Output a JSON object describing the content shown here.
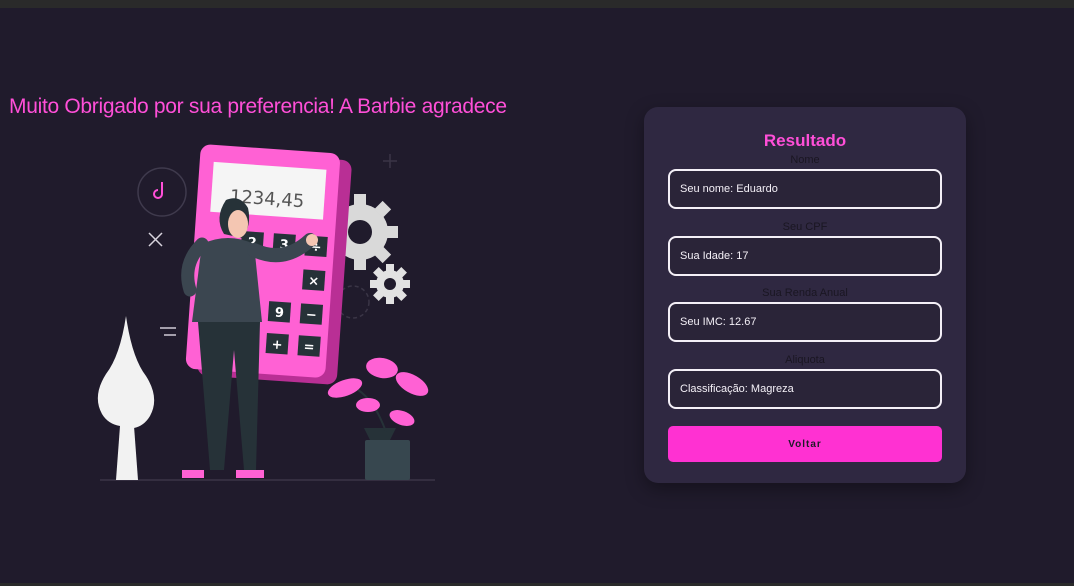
{
  "headline": "Muito Obrigado por sua preferencia! A Barbie agradece",
  "illustration": {
    "calculator_display": "1234,45",
    "keys": [
      "2",
      "3",
      "÷",
      "×",
      "9",
      "−",
      "+",
      "="
    ]
  },
  "card": {
    "title": "Resultado",
    "fields": [
      {
        "label": "Nome",
        "value": "Seu nome: Eduardo"
      },
      {
        "label": "Seu CPF",
        "value": "Sua Idade: 17"
      },
      {
        "label": "Sua Renda Anual",
        "value": "Seu IMC: 12.67"
      },
      {
        "label": "Aliquota",
        "value": "Classificação: Magreza"
      }
    ],
    "button_label": "Voltar"
  },
  "colors": {
    "background": "#201b2c",
    "accent": "#ff31d2",
    "card": "#2f2841"
  }
}
